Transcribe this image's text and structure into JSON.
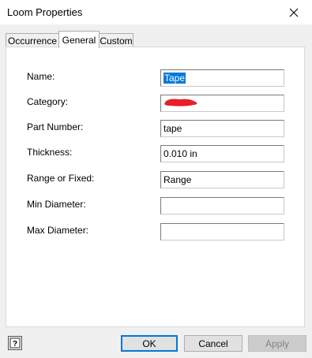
{
  "window": {
    "title": "Loom Properties",
    "close_symbol": "✕"
  },
  "tabs": [
    {
      "label": "Occurrence",
      "active": false
    },
    {
      "label": "General",
      "active": true
    },
    {
      "label": "Custom",
      "active": false
    }
  ],
  "fields": {
    "name": {
      "label": "Name:",
      "value": "Tape",
      "selected": true
    },
    "category": {
      "label": "Category:",
      "value": "",
      "redacted": true,
      "redaction_color": "#e8202a"
    },
    "part_number": {
      "label": "Part Number:",
      "value": "tape"
    },
    "thickness": {
      "label": "Thickness:",
      "value": "0.010 in"
    },
    "range_fixed": {
      "label": "Range or Fixed:",
      "value": "Range"
    },
    "min_diameter": {
      "label": "Min Diameter:",
      "value": ""
    },
    "max_diameter": {
      "label": "Max Diameter:",
      "value": ""
    }
  },
  "buttons": {
    "help_icon": "help-icon",
    "ok": "OK",
    "cancel": "Cancel",
    "apply": "Apply"
  },
  "colors": {
    "selection": "#0078d7",
    "default_button_border": "#0078d7"
  }
}
